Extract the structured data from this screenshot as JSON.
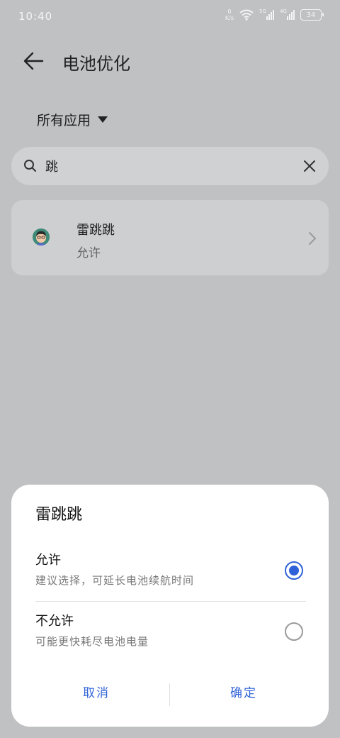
{
  "status_bar": {
    "time": "10:40",
    "net_speed_value": "0",
    "net_speed_unit": "K/s",
    "sim1_label": "5G",
    "sim2_label": "4G",
    "battery_level": "34",
    "icons": [
      "wifi-icon",
      "signal-icon",
      "battery-icon"
    ]
  },
  "header": {
    "title": "电池优化",
    "back_icon": "back-arrow-icon"
  },
  "filter": {
    "label": "所有应用",
    "icon": "dropdown-triangle-icon"
  },
  "search": {
    "value": "跳",
    "placeholder": "",
    "icons": [
      "search-icon",
      "clear-icon"
    ]
  },
  "app_list": [
    {
      "name": "雷跳跳",
      "status": "允许",
      "icon": "app-avatar-icon"
    }
  ],
  "dialog": {
    "title": "雷跳跳",
    "options": [
      {
        "title": "允许",
        "description": "建议选择，可延长电池续航时间",
        "selected": true
      },
      {
        "title": "不允许",
        "description": "可能更快耗尽电池电量",
        "selected": false
      }
    ],
    "cancel_label": "取消",
    "confirm_label": "确定"
  },
  "colors": {
    "background": "#c0c1c3",
    "accent": "#2f62d8",
    "sheet": "#ffffff"
  }
}
